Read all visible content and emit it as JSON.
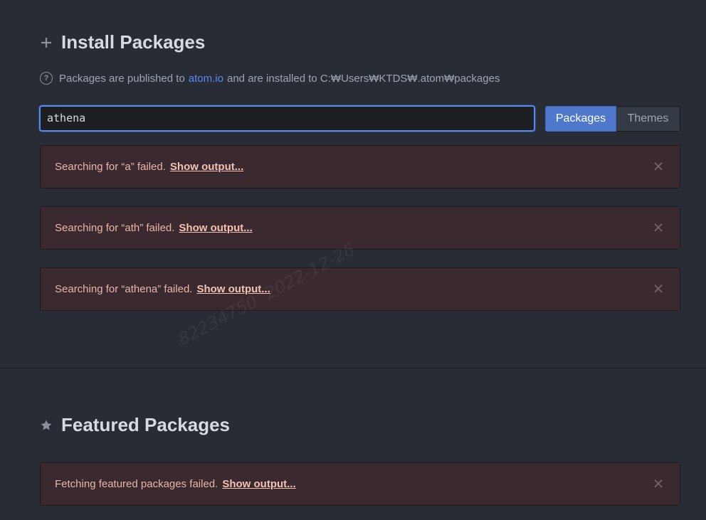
{
  "install": {
    "title": "Install Packages",
    "info_prefix": "Packages are published to",
    "info_link": "atom.io",
    "info_suffix": "and are installed to C:₩Users₩KTDS₩.atom₩packages",
    "search_value": "athena",
    "tabs": [
      {
        "label": "Packages",
        "active": true
      },
      {
        "label": "Themes",
        "active": false
      }
    ]
  },
  "alerts": [
    {
      "message": "Searching for “a” failed.",
      "action": "Show output..."
    },
    {
      "message": "Searching for “ath” failed.",
      "action": "Show output..."
    },
    {
      "message": "Searching for “athena” failed.",
      "action": "Show output..."
    }
  ],
  "featured": {
    "title": "Featured Packages",
    "alert": {
      "message": "Fetching featured packages failed.",
      "action": "Show output..."
    }
  },
  "watermark": {
    "id": "82234750",
    "date": "2022-12-26"
  },
  "colors": {
    "background": "#282c34",
    "accent": "#568af2",
    "active_button": "#4d78cc",
    "alert_background": "#3a2a2f",
    "alert_text": "#e8b5a8"
  }
}
